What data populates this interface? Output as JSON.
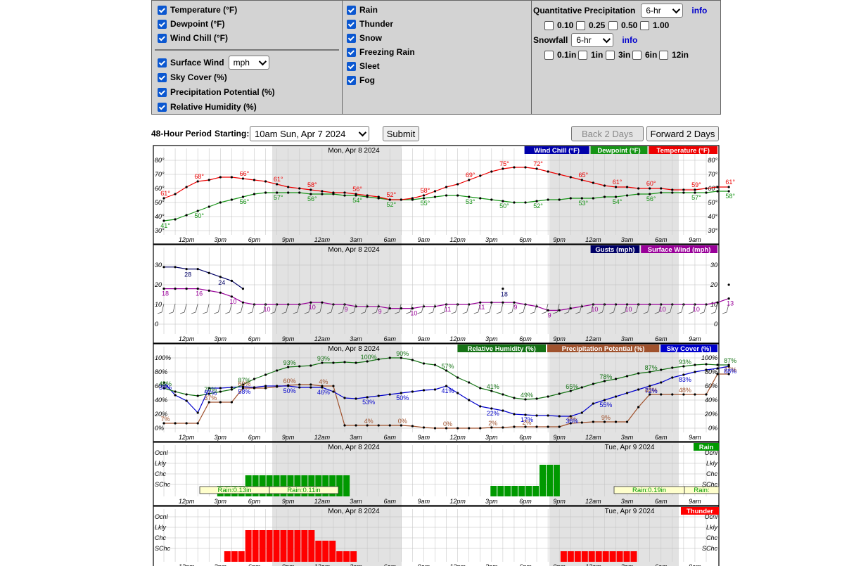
{
  "options": {
    "col1": [
      {
        "label": "Temperature (°F)",
        "checked": true
      },
      {
        "label": "Dewpoint (°F)",
        "checked": true
      },
      {
        "label": "Wind Chill (°F)",
        "checked": true
      }
    ],
    "surface_wind": {
      "label": "Surface Wind",
      "checked": true,
      "unit": "mph"
    },
    "col1b": [
      {
        "label": "Sky Cover (%)",
        "checked": true
      },
      {
        "label": "Precipitation Potential (%)",
        "checked": true
      },
      {
        "label": "Relative Humidity (%)",
        "checked": true
      }
    ],
    "col2": [
      {
        "label": "Rain",
        "checked": true
      },
      {
        "label": "Thunder",
        "checked": true
      },
      {
        "label": "Snow",
        "checked": true
      },
      {
        "label": "Freezing Rain",
        "checked": true
      },
      {
        "label": "Sleet",
        "checked": true
      },
      {
        "label": "Fog",
        "checked": true
      }
    ],
    "qpf": {
      "label": "Quantitative Precipitation",
      "select": "6-hr",
      "info": "info",
      "values": [
        "0.10",
        "0.25",
        "0.50",
        "1.00"
      ]
    },
    "snowfall": {
      "label": "Snowfall",
      "select": "6-hr",
      "info": "info",
      "values": [
        "0.1in",
        "1in",
        "3in",
        "6in",
        "12in"
      ]
    }
  },
  "period": {
    "label": "48-Hour Period",
    "starting_label": "Starting:",
    "start_value": "10am Sun, Apr 7 2024",
    "submit": "Submit",
    "back": "Back 2 Days",
    "forward": "Forward 2 Days"
  },
  "colors": {
    "temperature": "#ee0000",
    "dewpoint": "#169416",
    "windchill": "#0000aa",
    "gusts": "#000066",
    "wind": "#990099",
    "rh": "#167316",
    "pop": "#a0522d",
    "sky": "#0000cc",
    "rain": "#009900",
    "thunder": "#ff0000"
  },
  "chart_data": [
    {
      "type": "line",
      "title": "Temperature / Dewpoint / Wind Chill",
      "day_labels": [
        "Mon, Apr 8 2024"
      ],
      "x_tick_labels": [
        "12pm",
        "3pm",
        "6pm",
        "9pm",
        "12am",
        "3am",
        "6am",
        "9am",
        "12pm",
        "3pm",
        "6pm",
        "9pm",
        "12am",
        "3am",
        "6am",
        "9am"
      ],
      "ylim": [
        30,
        80
      ],
      "y_ticks": [
        "30°",
        "40°",
        "50°",
        "60°",
        "70°",
        "80°"
      ],
      "legend": [
        "Wind Chill (°F)",
        "Dewpoint (°F)",
        "Temperature (°F)"
      ],
      "series": [
        {
          "name": "Temperature (°F)",
          "values": [
            53,
            56,
            61,
            65,
            66,
            68,
            68,
            67,
            66,
            65,
            63,
            61,
            60,
            59,
            58,
            57,
            57,
            56,
            55,
            54,
            52,
            52,
            53,
            55,
            58,
            61,
            63,
            66,
            69,
            72,
            74,
            75,
            75,
            74,
            72,
            70,
            68,
            66,
            64,
            62,
            61,
            61,
            60,
            60,
            60,
            59,
            59,
            59,
            60,
            61,
            61
          ]
        },
        {
          "name": "Dewpoint (°F)",
          "values": [
            37,
            38,
            41,
            44,
            47,
            50,
            52,
            54,
            56,
            57,
            57,
            57,
            57,
            56,
            56,
            56,
            55,
            55,
            54,
            53,
            52,
            52,
            52,
            53,
            54,
            55,
            55,
            54,
            53,
            52,
            51,
            50,
            50,
            51,
            52,
            52,
            53,
            53,
            53,
            54,
            54,
            55,
            56,
            56,
            57,
            57,
            57,
            57,
            57,
            58,
            58
          ]
        }
      ],
      "labels": {
        "temperature": [
          "61°",
          "68°",
          "66°",
          "61°",
          "58°",
          "56°",
          "52°",
          "58°",
          "69°",
          "75°",
          "72°",
          "65°",
          "61°",
          "60°",
          "59°",
          "61°"
        ],
        "dewpoint": [
          "41°",
          "50°",
          "56°",
          "57°",
          "56°",
          "54°",
          "52°",
          "55°",
          "53°",
          "50°",
          "52°",
          "53°",
          "54°",
          "56°",
          "57°",
          "58°"
        ]
      }
    },
    {
      "type": "line",
      "title": "Surface Wind / Gusts",
      "day_labels": [
        "Mon, Apr 8 2024"
      ],
      "x_tick_labels": [
        "12pm",
        "3pm",
        "6pm",
        "9pm",
        "12am",
        "3am",
        "6am",
        "9am",
        "12pm",
        "3pm",
        "6pm",
        "9pm",
        "12am",
        "3am",
        "6am",
        "9am"
      ],
      "ylim": [
        0,
        35
      ],
      "y_ticks": [
        "0",
        "10",
        "20",
        "30"
      ],
      "legend": [
        "Gusts (mph)",
        "Surface Wind (mph)"
      ],
      "series": [
        {
          "name": "Surface Wind (mph)",
          "values": [
            18,
            18,
            18,
            18,
            17,
            16,
            14,
            11,
            10,
            10,
            10,
            10,
            10,
            11,
            11,
            10,
            10,
            9,
            9,
            9,
            8,
            8,
            8,
            9,
            9,
            10,
            10,
            10,
            11,
            11,
            11,
            11,
            10,
            9,
            7,
            7,
            8,
            9,
            10,
            10,
            10,
            10,
            10,
            10,
            10,
            10,
            10,
            10,
            10,
            11,
            13
          ]
        },
        {
          "name": "Gusts (mph)",
          "values": [
            29,
            29,
            28,
            28,
            26,
            24,
            22,
            18,
            null,
            null,
            null,
            null,
            null,
            null,
            null,
            null,
            null,
            null,
            null,
            null,
            null,
            null,
            null,
            null,
            null,
            null,
            null,
            null,
            null,
            null,
            18,
            null,
            null,
            null,
            null,
            null,
            null,
            null,
            null,
            null,
            null,
            null,
            null,
            null,
            null,
            null,
            null,
            null,
            null,
            null,
            20
          ]
        }
      ],
      "labels": {
        "wind": [
          "18",
          "16",
          "10",
          "10",
          "10",
          "9",
          "9",
          "10",
          "11",
          "11",
          "9",
          "9",
          "10",
          "10",
          "10",
          "10",
          "13"
        ],
        "gusts": [
          "28",
          "24",
          "18",
          "20"
        ]
      }
    },
    {
      "type": "line",
      "title": "Relative Humidity / Precipitation Potential / Sky Cover",
      "day_labels": [
        "Mon, Apr 8 2024"
      ],
      "x_tick_labels": [
        "12pm",
        "3pm",
        "6pm",
        "9pm",
        "12am",
        "3am",
        "6am",
        "9am",
        "12pm",
        "3pm",
        "6pm",
        "9pm",
        "12am",
        "3am",
        "6am",
        "9am"
      ],
      "ylim": [
        0,
        100
      ],
      "y_ticks": [
        "0%",
        "20%",
        "40%",
        "60%",
        "80%",
        "100%"
      ],
      "legend": [
        "Relative Humidity (%)",
        "Precipitation Potential (%)",
        "Sky Cover (%)"
      ],
      "series": [
        {
          "name": "Relative Humidity (%)",
          "values": [
            57,
            52,
            48,
            46,
            49,
            52,
            55,
            62,
            70,
            76,
            82,
            87,
            88,
            89,
            93,
            93,
            94,
            93,
            95,
            98,
            100,
            100,
            97,
            92,
            90,
            82,
            72,
            65,
            57,
            53,
            48,
            43,
            41,
            42,
            45,
            49,
            53,
            58,
            63,
            67,
            70,
            74,
            78,
            80,
            83,
            86,
            88,
            90,
            91,
            90,
            90
          ]
        },
        {
          "name": "Precipitation Potential (%)",
          "values": [
            7,
            7,
            7,
            7,
            37,
            37,
            37,
            57,
            57,
            57,
            59,
            61,
            62,
            62,
            60,
            60,
            4,
            4,
            4,
            4,
            4,
            4,
            3,
            1,
            0,
            0,
            0,
            0,
            0,
            1,
            1,
            2,
            2,
            2,
            2,
            2,
            7,
            8,
            9,
            9,
            9,
            9,
            30,
            48,
            48,
            48,
            48,
            48,
            48,
            77,
            77
          ]
        },
        {
          "name": "Sky Cover (%)",
          "values": [
            65,
            47,
            39,
            22,
            57,
            57,
            58,
            59,
            58,
            60,
            60,
            60,
            58,
            58,
            58,
            52,
            43,
            42,
            44,
            46,
            48,
            50,
            52,
            54,
            55,
            60,
            50,
            40,
            31,
            28,
            25,
            20,
            19,
            18,
            18,
            17,
            17,
            22,
            35,
            40,
            45,
            50,
            55,
            60,
            65,
            72,
            76,
            80,
            83,
            85,
            88
          ]
        }
      ],
      "labels": {
        "rh": [
          "48%",
          "70%",
          "87%",
          "93%",
          "93%",
          "100%",
          "90%",
          "57%",
          "41%",
          "49%",
          "65%",
          "78%",
          "87%",
          "93%",
          "87%"
        ],
        "pop": [
          "7%",
          "37%",
          "60%",
          "60%",
          "4%",
          "4%",
          "0%",
          "0%",
          "2%",
          "2%",
          "9%",
          "9%",
          "48%",
          "48%",
          "77%"
        ],
        "sky": [
          "39%",
          "57%",
          "58%",
          "50%",
          "46%",
          "53%",
          "50%",
          "41%",
          "22%",
          "17%",
          "36%",
          "55%",
          "72%",
          "83%",
          "88%"
        ]
      }
    },
    {
      "type": "bar",
      "title": "Rain",
      "day_labels": [
        "Mon, Apr 8 2024",
        "Tue, Apr 9 2024"
      ],
      "y_ticks": [
        "SChc",
        "Chc",
        "Lkly",
        "Ocnl"
      ],
      "legend": [
        "Rain"
      ],
      "values": [
        0,
        0,
        0,
        0,
        1,
        1,
        1,
        1,
        2,
        2,
        2,
        2,
        2,
        2,
        2,
        2,
        2,
        2,
        2,
        2,
        2,
        2,
        2,
        0,
        0,
        0,
        0,
        0,
        0,
        0,
        0,
        0,
        0,
        0,
        0,
        0,
        0,
        0,
        0,
        0,
        0,
        0,
        0,
        1,
        1,
        1,
        1,
        1,
        1,
        1,
        3,
        3,
        3
      ],
      "amounts": [
        "Rain:0.13in",
        "Rain:0.11in",
        "Rain:0.19in",
        "Rain:"
      ]
    },
    {
      "type": "bar",
      "title": "Thunder",
      "day_labels": [
        "Mon, Apr 8 2024",
        "Tue, Apr 9 2024"
      ],
      "y_ticks": [
        "SChc",
        "Chc",
        "Lkly",
        "Ocnl"
      ],
      "legend": [
        "Thunder"
      ],
      "values": [
        0,
        0,
        0,
        0,
        0,
        1,
        1,
        1,
        3,
        3,
        3,
        3,
        3,
        3,
        3,
        3,
        3,
        3,
        2,
        2,
        2,
        1,
        1,
        1,
        0,
        0,
        0,
        0,
        0,
        0,
        0,
        0,
        0,
        0,
        0,
        0,
        0,
        0,
        0,
        0,
        0,
        0,
        0,
        0,
        0,
        0,
        0,
        0,
        0,
        0,
        0,
        0,
        0,
        1,
        1,
        1,
        1,
        1,
        1,
        1,
        1,
        1,
        1,
        1,
        0
      ]
    }
  ]
}
